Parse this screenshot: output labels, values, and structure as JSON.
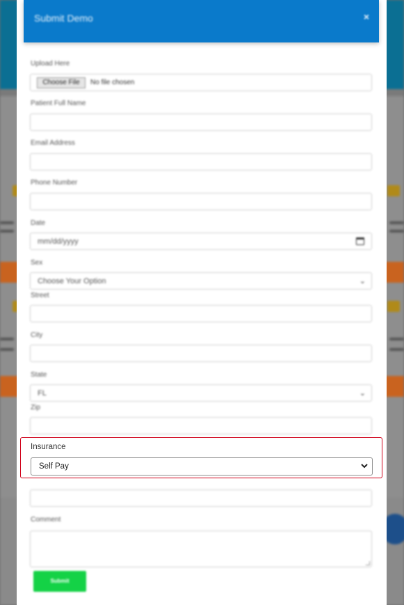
{
  "modal": {
    "title": "Submit Demo",
    "close_icon": "close-icon",
    "header_color": "#0a7acb"
  },
  "form": {
    "upload": {
      "label": "Upload Here",
      "button_label": "Choose File",
      "status": "No file chosen"
    },
    "patient_name": {
      "label": "Patient Full Name",
      "value": ""
    },
    "email": {
      "label": "Email Address",
      "value": ""
    },
    "phone": {
      "label": "Phone Number",
      "value": ""
    },
    "date": {
      "label": "Date",
      "placeholder": "mm/dd/yyyy",
      "icon": "calendar-icon"
    },
    "sex": {
      "label": "Sex",
      "selected": "Choose Your Option"
    },
    "street": {
      "label": "Street",
      "value": ""
    },
    "city": {
      "label": "City",
      "value": ""
    },
    "state": {
      "label": "State",
      "selected": "FL"
    },
    "zip": {
      "label": "Zip",
      "value": ""
    },
    "insurance": {
      "label": "Insurance",
      "selected": "Self Pay",
      "highlight_color": "#d0021b"
    },
    "comment": {
      "label": "Comment",
      "value": ""
    },
    "submit_label": "Submit",
    "submit_color": "#14d246"
  }
}
